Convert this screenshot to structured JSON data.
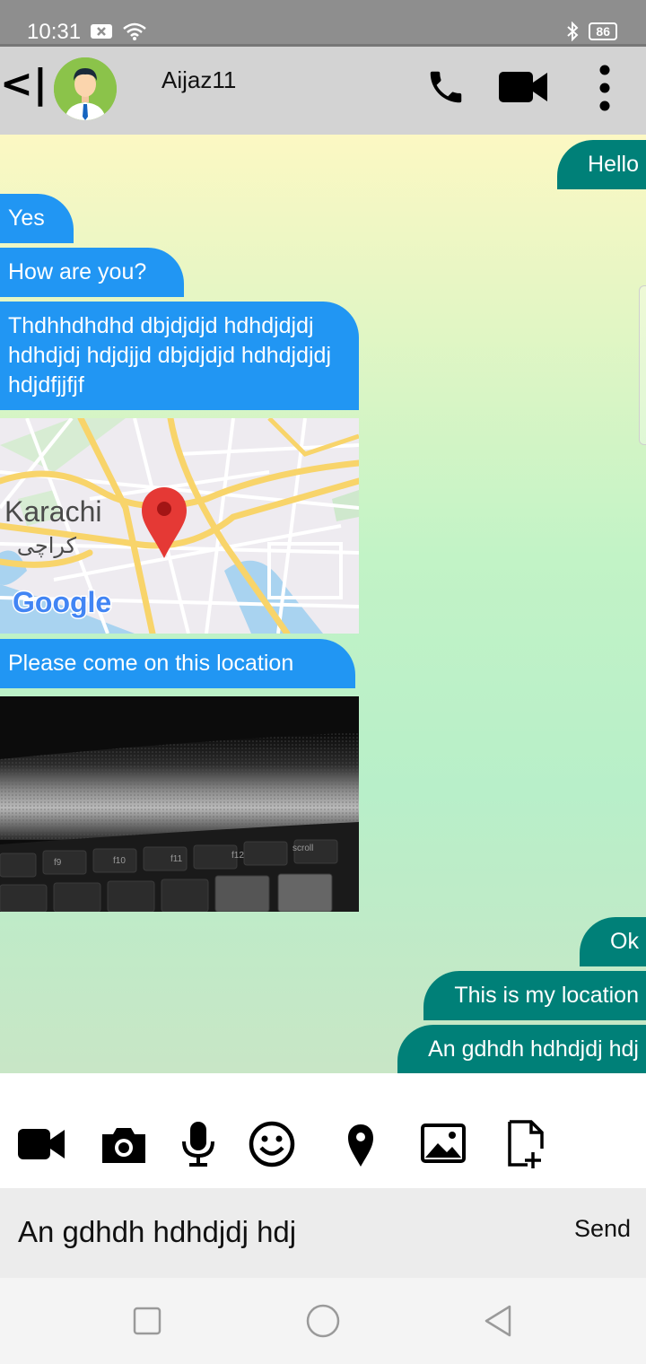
{
  "status_bar": {
    "time": "10:31",
    "battery": "86",
    "icons": [
      "notification-x-icon",
      "wifi-icon",
      "bluetooth-icon",
      "battery-icon"
    ]
  },
  "header": {
    "back_label": "<|",
    "contact_name": "Aijaz11",
    "icons": [
      "avatar",
      "phone-icon",
      "video-call-icon",
      "more-vert-icon"
    ]
  },
  "messages": [
    {
      "direction": "out",
      "text": "Hello"
    },
    {
      "direction": "in",
      "text": "Yes"
    },
    {
      "direction": "in",
      "text": "How are you?"
    },
    {
      "direction": "in",
      "text": "Thdhhdhdhd dbjdjdjd hdhdjdjdj hdhdjdj hdjdjjd dbjdjdjd hdhdjdjdj hdjdfjjfjf"
    },
    {
      "direction": "in",
      "type": "map",
      "labels": {
        "city": "Karachi",
        "city_urdu": "کراچی",
        "brand": "Google"
      }
    },
    {
      "direction": "in",
      "text": "Please come on this location"
    },
    {
      "direction": "in",
      "type": "photo",
      "keys": [
        "f9",
        "f10",
        "f11",
        "f12",
        "scroll"
      ]
    },
    {
      "direction": "out",
      "text": "Ok"
    },
    {
      "direction": "out",
      "text": "This is my location"
    },
    {
      "direction": "out",
      "text": "An gdhdh hdhdjdj hdj"
    }
  ],
  "attachments": [
    "video-icon",
    "camera-icon",
    "microphone-icon",
    "emoji-icon",
    "location-pin-icon",
    "image-icon",
    "add-file-icon"
  ],
  "composer": {
    "value": "An gdhdh hdhdjdj hdj",
    "send_label": "Send"
  },
  "navigation": [
    "recent-apps-icon",
    "home-icon",
    "back-icon"
  ],
  "colors": {
    "incoming_bubble": "#2196f3",
    "outgoing_bubble": "#008078",
    "app_bar": "#d3d3d3",
    "status_bar": "#8e8e8e"
  }
}
